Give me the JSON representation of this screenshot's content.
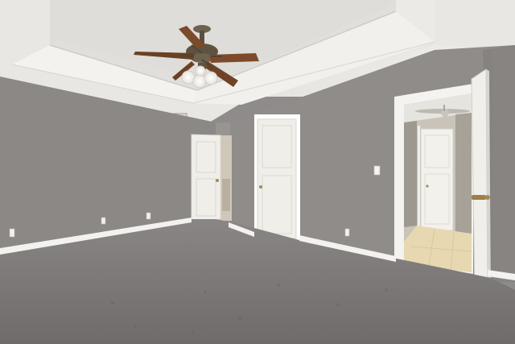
{
  "scene": {
    "kind": "photo",
    "subject": "empty-bedroom",
    "features": [
      "tray-ceiling",
      "ceiling-fan",
      "carpet-floor",
      "closet-doors",
      "open-doorway-to-bathroom"
    ]
  },
  "colors": {
    "wall": "#8c8987",
    "wall_light": "#9b9896",
    "ceiling": "#e9e8e6",
    "tray_inner": "#e2e1de",
    "carpet": "#7f7b7a",
    "trim": "#f4f3f0",
    "door": "#f1f0ec",
    "tile": "#e8d9b4",
    "fan_blade": "#7a4a2a",
    "fan_metal": "#5a4e3e"
  }
}
